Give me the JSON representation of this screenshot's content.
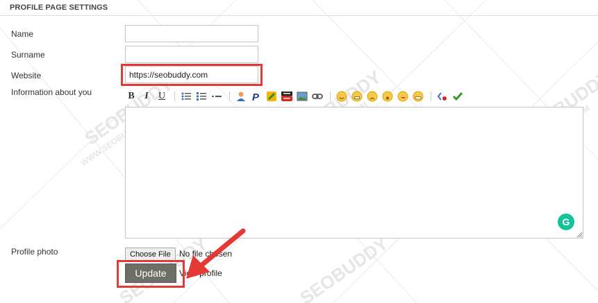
{
  "section": {
    "title": "PROFILE PAGE SETTINGS"
  },
  "fields": {
    "name": {
      "label": "Name",
      "value": ""
    },
    "surname": {
      "label": "Surname",
      "value": ""
    },
    "website": {
      "label": "Website",
      "value": "https://seobuddy.com"
    },
    "info": {
      "label": "Information about you",
      "value": ""
    }
  },
  "toolbar": {
    "bold": "B",
    "italic": "I",
    "underline": "U",
    "icons": [
      "bold-icon",
      "italic-icon",
      "underline-icon",
      "unordered-list-icon",
      "ordered-list-icon",
      "horizontal-rule-icon",
      "user-icon",
      "paypal-icon",
      "nofollow-icon",
      "youtube-icon",
      "image-icon",
      "link-icon",
      "smile-icon",
      "laugh-icon",
      "sad-icon",
      "surprised-icon",
      "wink-icon",
      "grin-icon",
      "code-icon",
      "spellcheck-icon"
    ]
  },
  "profile_photo": {
    "label": "Profile photo",
    "choose_button": "Choose File",
    "file_status": "No file chosen"
  },
  "actions": {
    "update_label": "Update",
    "view_profile_label": "View profile"
  },
  "watermark": {
    "text": "SEOBUDDY",
    "subtext": "WWW.SEOBUDDY.COM"
  },
  "colors": {
    "highlight": "#e53935",
    "update_button": "#6e6e66",
    "grammarly": "#15c39a"
  }
}
